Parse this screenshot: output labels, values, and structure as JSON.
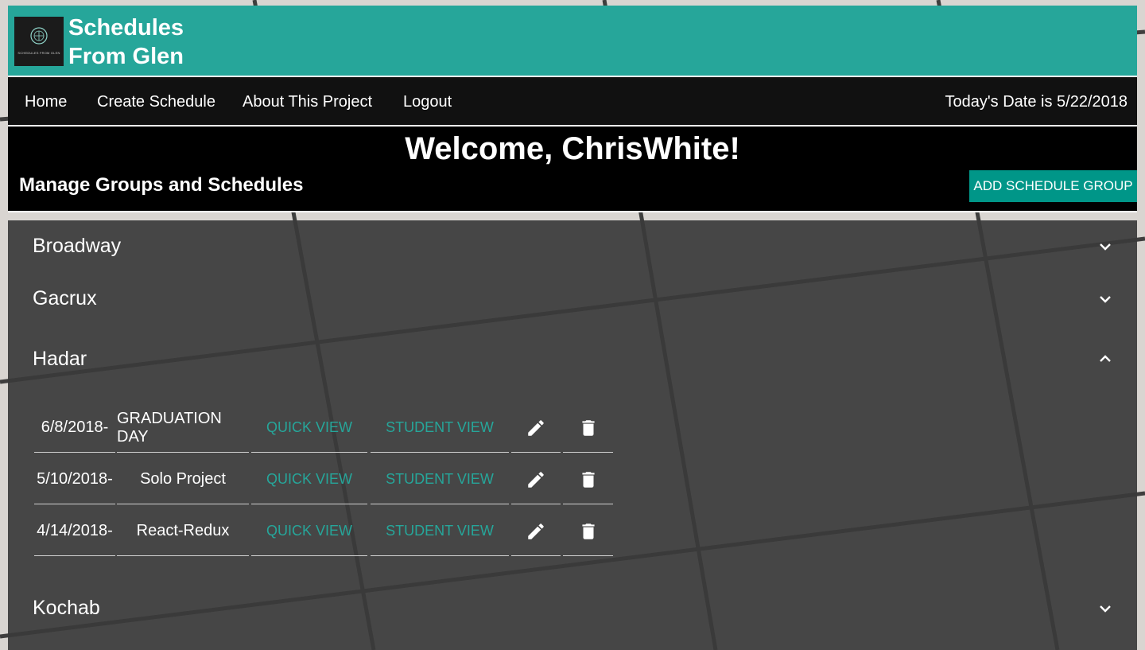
{
  "app": {
    "logo_text": "SCHEDULES FROM GLEN",
    "title_line1": "Schedules",
    "title_line2": "From Glen"
  },
  "nav": {
    "items": [
      {
        "label": "Home"
      },
      {
        "label": "Create Schedule"
      },
      {
        "label": "About This Project"
      },
      {
        "label": "Logout"
      }
    ],
    "today": "Today's Date is 5/22/2018"
  },
  "welcome": {
    "title": "Welcome, ChrisWhite!",
    "subtitle": "Manage Groups and Schedules",
    "add_button": "ADD SCHEDULE GROUP"
  },
  "groups": [
    {
      "name": "Broadway",
      "expanded": false,
      "icon": "chevron-down-icon"
    },
    {
      "name": "Gacrux",
      "expanded": false,
      "icon": "chevron-down-icon"
    },
    {
      "name": "Hadar",
      "expanded": true,
      "icon": "chevron-up-icon"
    },
    {
      "name": "Kochab",
      "expanded": false,
      "icon": "chevron-down-icon"
    }
  ],
  "schedules": [
    {
      "date": "6/8/2018-",
      "name": "GRADUATION DAY",
      "quick": "QUICK VIEW",
      "student": "STUDENT VIEW",
      "edit_icon": "pencil-icon",
      "delete_icon": "trash-icon"
    },
    {
      "date": "5/10/2018-",
      "name": "Solo Project",
      "quick": "QUICK VIEW",
      "student": "STUDENT VIEW",
      "edit_icon": "pencil-icon",
      "delete_icon": "trash-icon"
    },
    {
      "date": "4/14/2018-",
      "name": "React-Redux",
      "quick": "QUICK VIEW",
      "student": "STUDENT VIEW",
      "edit_icon": "pencil-icon",
      "delete_icon": "trash-icon"
    }
  ],
  "colors": {
    "accent": "#26a69a",
    "button": "#009688",
    "nav_bg": "#111111",
    "panel_bg": "#3a3a3a"
  }
}
